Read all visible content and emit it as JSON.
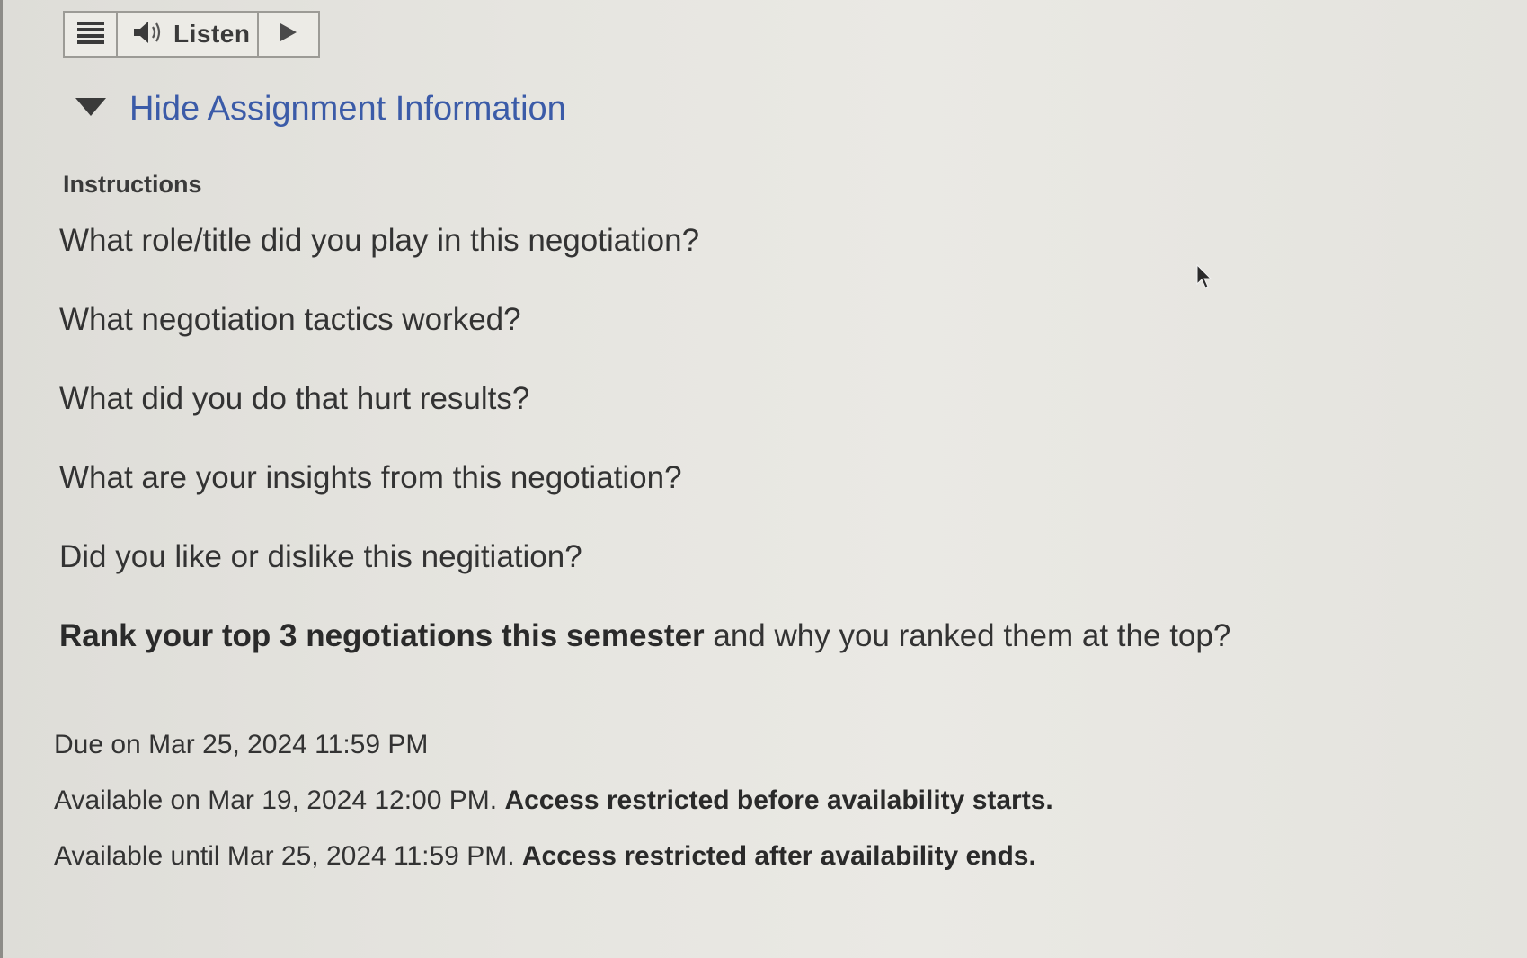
{
  "toolbar": {
    "menu_icon": "hamburger-icon",
    "speaker_icon": "speaker-icon",
    "listen_label": "Listen",
    "play_icon": "play-icon"
  },
  "assignment": {
    "toggle_label": "Hide Assignment Information",
    "toggle_icon": "caret-down-icon",
    "instructions_heading": "Instructions",
    "questions": [
      "What role/title did you play in this negotiation?",
      "What negotiation tactics worked?",
      "What did you do that hurt results?",
      "What are your insights from this negotiation?",
      "Did you like or dislike this negitiation?"
    ],
    "rank_question_bold": "Rank your top 3 negotiations this semester",
    "rank_question_rest": " and why you ranked them at the top?"
  },
  "availability": {
    "due": "Due on Mar 25, 2024 11:59 PM",
    "available_on_prefix": "Available on Mar 19, 2024 12:00 PM. ",
    "available_on_note": "Access restricted before availability starts.",
    "available_until_prefix": "Available until Mar 25, 2024 11:59 PM. ",
    "available_until_note": "Access restricted after availability ends."
  },
  "colors": {
    "link": "#3b5ba8",
    "text": "#333333",
    "background": "#e6e5e0"
  }
}
